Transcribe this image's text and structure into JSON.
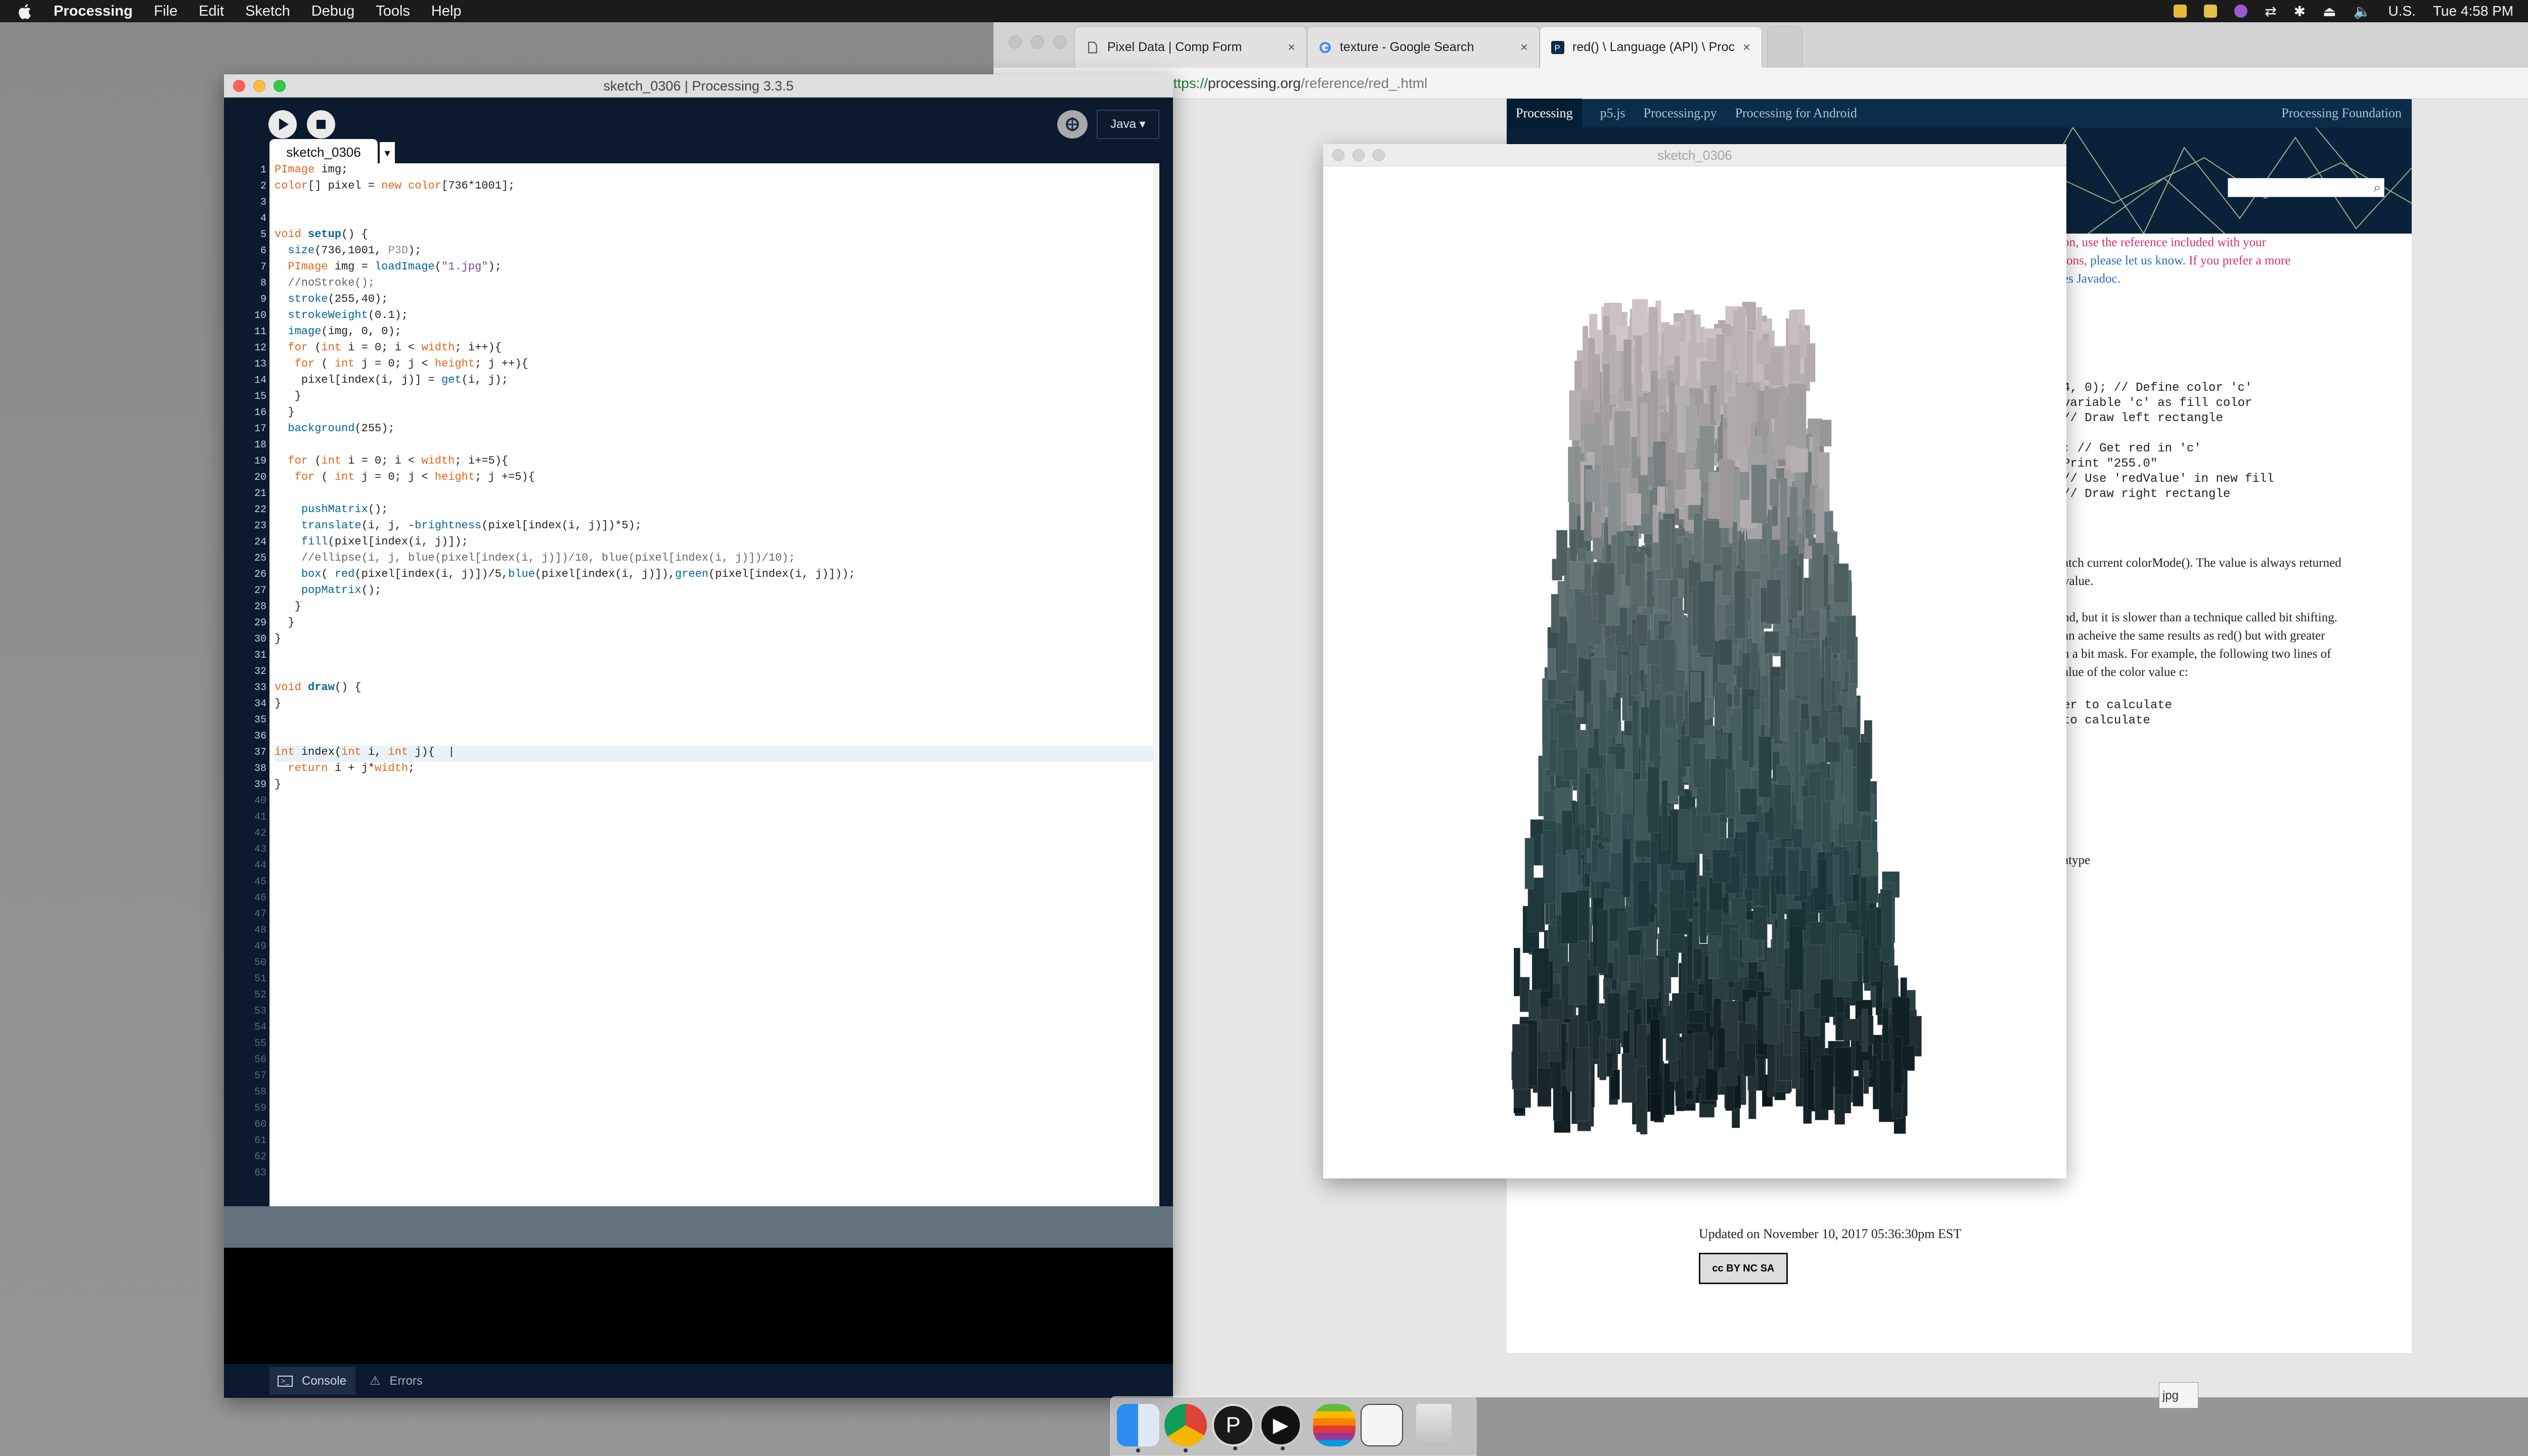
{
  "menubar": {
    "app": "Processing",
    "items": [
      "File",
      "Edit",
      "Sketch",
      "Debug",
      "Tools",
      "Help"
    ],
    "input_source": "U.S.",
    "clock": "Tue 4:58 PM"
  },
  "browser": {
    "tabs": [
      {
        "title": "Pixel Data | Comp Form",
        "close": "×"
      },
      {
        "title": "texture - Google Search",
        "close": "×"
      },
      {
        "title": "red() \\ Language (API) \\ Proce",
        "close": "×"
      }
    ],
    "url_protocol": "https://",
    "url_host": "processing.org",
    "url_path": "/reference/red_.html",
    "format_select": "jpg"
  },
  "reference_page": {
    "nav": [
      "Processing",
      "p5.js",
      "Processing.py",
      "Processing for Android"
    ],
    "nav_right": "Processing Foundation",
    "intro_line1": "on, use the reference included with your",
    "intro_line2a": "ions, ",
    "intro_link": "please let us know",
    "intro_line2b": ". If you prefer a more",
    "intro_line3": "es Javadoc.",
    "code_lines": [
      "4, 0);  // Define color 'c'",
      "variable 'c' as fill color",
      "// Draw left rectangle",
      ";  // Get red in 'c'",
      "Print \"255.0\"",
      "// Use 'redValue' in new fill",
      "// Draw right rectangle"
    ],
    "desc_lines": [
      "atch current colorMode(). The value is always returned",
      " value.",
      "nd, but it is slower than a technique called bit shifting.",
      "an acheive the same results as red() but with greater",
      "n a bit mask. For example, the following two lines of",
      "alue of the color value c:",
      "er to calculate",
      " to calculate",
      "atype"
    ],
    "updated": "Updated on November 10, 2017 05:36:30pm EST",
    "license": "cc BY NC SA"
  },
  "sketch_window": {
    "title": "sketch_0306"
  },
  "ide": {
    "title": "sketch_0306 | Processing 3.3.5",
    "mode": "Java ▾",
    "tab": "sketch_0306",
    "tab_arrow": "▾",
    "console_label": "Console",
    "errors_label": "Errors",
    "line_count": 63,
    "current_line": 37
  },
  "dock": {
    "apps": [
      "Finder",
      "Google Chrome",
      "Processing",
      "QuickTime Player",
      "Apple",
      "Preview",
      "Trash"
    ]
  }
}
